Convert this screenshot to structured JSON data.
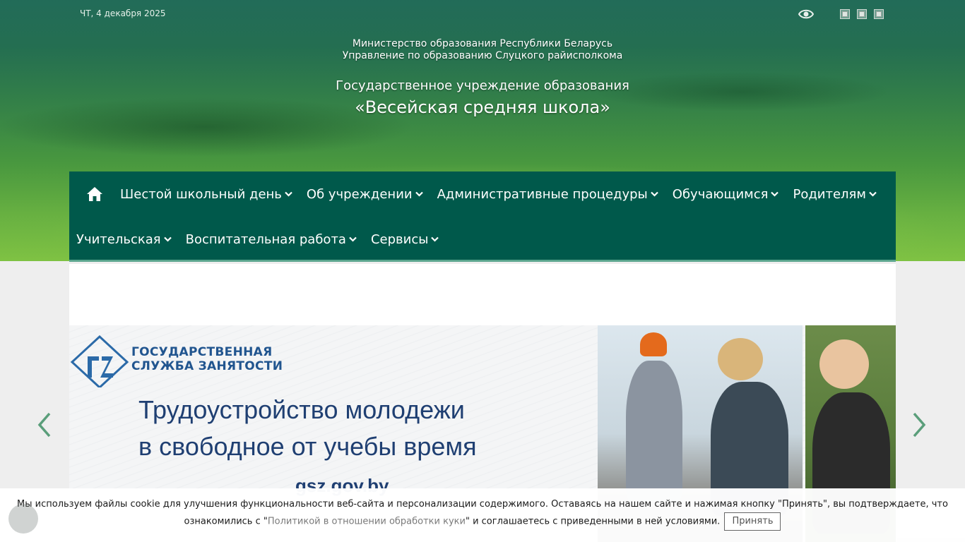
{
  "header": {
    "date": "ЧТ, 4 декабря 2025",
    "ministry": "Министерство образования Республики Беларусь",
    "department": "Управление по образованию Слуцкого райисполкома",
    "org_type": "Государственное учреждение образования",
    "school_name": "«Весейская средняя школа»",
    "icons": [
      "eye-icon",
      "flag-icon",
      "flag-icon",
      "flag-icon"
    ]
  },
  "nav": {
    "row1": [
      "Шестой школьный день",
      "Об учреждении",
      "Административные процедуры",
      "Обучающимся",
      "Родителям"
    ],
    "row2": [
      "Учительская",
      "Воспитательная работа",
      "Сервисы"
    ]
  },
  "banner": {
    "agency_line1": "ГОСУДАРСТВЕННАЯ",
    "agency_line2": "СЛУЖБА ЗАНЯТОСТИ",
    "title_line1": "Трудоустройство молодежи",
    "title_line2": "в свободное от учебы время",
    "url": "gsz.gov.by"
  },
  "cookie": {
    "text_before": "Мы используем файлы cookie для улучшения функциональности веб-сайта и персонализации содержимого. Оставаясь на нашем сайте и нажимая кнопку \"Принять\", вы подтверждаете, что ознакомились с \"",
    "link": "Политикой в отношении обработки куки",
    "text_after": "\" и соглашаетесь с приведенными в ней условиями.",
    "accept": "Принять"
  },
  "colors": {
    "nav_bg": "#00594b",
    "nav_border": "#5ca68e",
    "arrow": "#5a9e7a",
    "banner_text": "#1f3f72"
  }
}
